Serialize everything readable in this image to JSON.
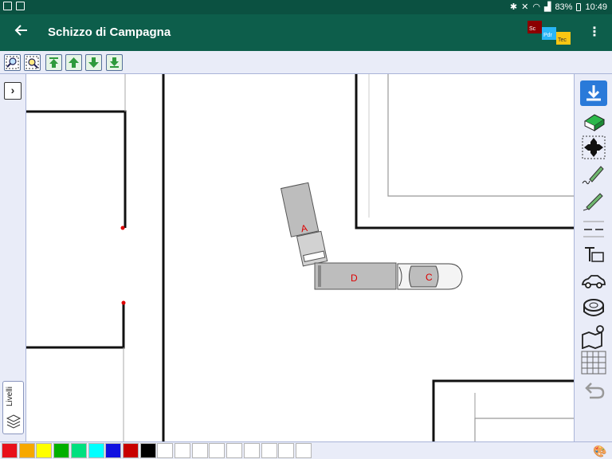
{
  "statusbar": {
    "battery": "83%",
    "time": "10:49"
  },
  "appbar": {
    "title": "Schizzo di Campagna",
    "logo_texts": [
      "Sc",
      "Pdr",
      "Tec"
    ]
  },
  "toolbar": {
    "buttons": [
      "zoom-fit-icon",
      "zoom-selection-icon",
      "move-top-icon",
      "move-up-icon",
      "move-down-icon",
      "move-bottom-icon"
    ]
  },
  "left_panel": {
    "layers_label": "Livelli"
  },
  "canvas": {
    "vehicles": [
      {
        "label": "A",
        "type": "truck"
      },
      {
        "label": "D",
        "type": "trailer"
      },
      {
        "label": "C",
        "type": "car"
      }
    ]
  },
  "right_tools": [
    "download-icon",
    "eraser-icon",
    "move-icon",
    "freehand-icon",
    "pencil-icon",
    "dashed-line-icon",
    "text-icon",
    "car-icon",
    "measure-tape-icon",
    "map-icon",
    "grid-icon",
    "undo-icon"
  ],
  "colors": [
    "#e8101a",
    "#f7a800",
    "#ffff00",
    "#00b000",
    "#00e080",
    "#00ffff",
    "#1010e0",
    "#c80000",
    "#000000",
    "#ffffff",
    "#ffffff",
    "#ffffff",
    "#ffffff",
    "#ffffff",
    "#ffffff",
    "#ffffff",
    "#ffffff",
    "#ffffff"
  ]
}
